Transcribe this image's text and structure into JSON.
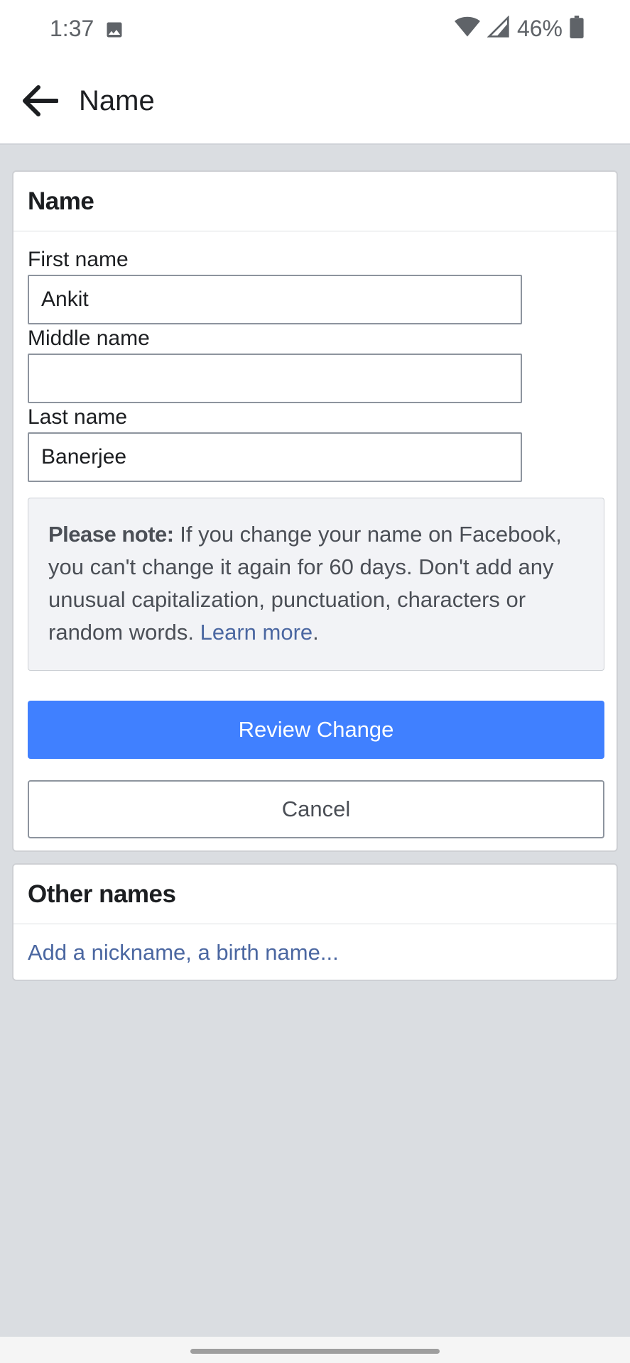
{
  "status_bar": {
    "time": "1:37",
    "battery": "46%",
    "icons": [
      "image-icon",
      "wifi-icon",
      "signal-icon",
      "battery-icon"
    ]
  },
  "app_bar": {
    "title": "Name",
    "back_icon": "arrow-left-icon"
  },
  "name_card": {
    "title": "Name",
    "first_name": {
      "label": "First name",
      "value": "Ankit"
    },
    "middle_name": {
      "label": "Middle name",
      "value": ""
    },
    "last_name": {
      "label": "Last name",
      "value": "Banerjee"
    },
    "note": {
      "bold": "Please note:",
      "text": " If you change your name on Facebook, you can't change it again for 60 days. Don't add any unusual capitalization, punctuation, characters or random words. ",
      "link": "Learn more",
      "end": "."
    },
    "review_button": "Review Change",
    "cancel_button": "Cancel"
  },
  "other_names_card": {
    "title": "Other names",
    "add_link": "Add a nickname, a birth name..."
  },
  "colors": {
    "primary_button": "#4080ff",
    "link": "#4b67a1",
    "background": "#dadde1"
  }
}
